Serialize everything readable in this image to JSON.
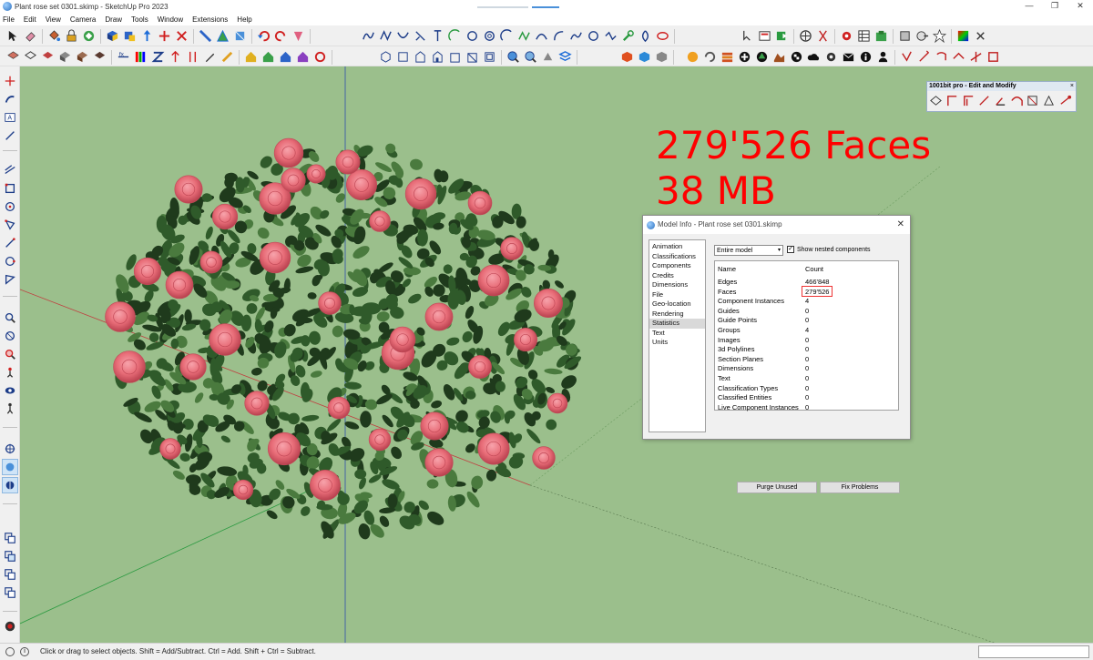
{
  "window": {
    "title": "Plant rose set 0301.skimp - SketchUp Pro 2023",
    "controls": [
      "—",
      "❐",
      "✕"
    ]
  },
  "menu": [
    "File",
    "Edit",
    "View",
    "Camera",
    "Draw",
    "Tools",
    "Window",
    "Extensions",
    "Help"
  ],
  "annotation": {
    "faces_line": "279'526 Faces",
    "size_line": "38 MB",
    "color": "#ff0000"
  },
  "floating_toolbar": {
    "title": "1001bit pro - Edit and Modify",
    "close": "×"
  },
  "model_info": {
    "title": "Model Info - Plant rose set 0301.skimp",
    "close": "✕",
    "nav": [
      "Animation",
      "Classifications",
      "Components",
      "Credits",
      "Dimensions",
      "File",
      "Geo-location",
      "Rendering",
      "Statistics",
      "Text",
      "Units"
    ],
    "selected_nav": "Statistics",
    "scope": "Entire model",
    "scope_arrow": "▾",
    "show_nested_label": "Show nested components",
    "show_nested_checked": "✓",
    "columns": {
      "name": "Name",
      "count": "Count"
    },
    "rows": [
      {
        "name": "Edges",
        "count": "466'848"
      },
      {
        "name": "Faces",
        "count": "279'526"
      },
      {
        "name": "Component Instances",
        "count": "4"
      },
      {
        "name": "Guides",
        "count": "0"
      },
      {
        "name": "Guide Points",
        "count": "0"
      },
      {
        "name": "Groups",
        "count": "4"
      },
      {
        "name": "Images",
        "count": "0"
      },
      {
        "name": "3d Polylines",
        "count": "0"
      },
      {
        "name": "Section Planes",
        "count": "0"
      },
      {
        "name": "Dimensions",
        "count": "0"
      },
      {
        "name": "Text",
        "count": "0"
      },
      {
        "name": "Classification Types",
        "count": "0"
      },
      {
        "name": "Classified Entities",
        "count": "0"
      },
      {
        "name": "Live Component Instances",
        "count": "0"
      }
    ],
    "purge_button": "Purge Unused",
    "fix_button": "Fix Problems"
  },
  "statusbar": {
    "hint": "Click or drag to select objects. Shift = Add/Subtract. Ctrl = Add. Shift + Ctrl = Subtract.",
    "info_icon": "i"
  },
  "colors": {
    "viewport_bg": "#9bbf8c",
    "leaf_dark": "#1f3a1c",
    "leaf_mid": "#2f5a2a",
    "rose": "#e86d78",
    "rose_dark": "#c24a58"
  }
}
